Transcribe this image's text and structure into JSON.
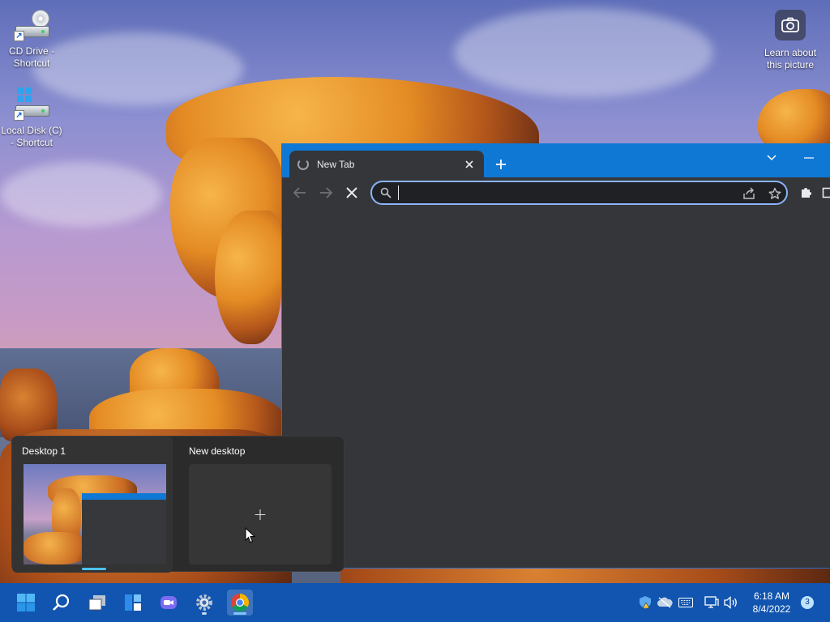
{
  "desktop": {
    "icons": [
      {
        "label": "CD Drive - Shortcut"
      },
      {
        "label": "Local Disk (C) - Shortcut"
      }
    ],
    "learn_picture": {
      "label": "Learn about this picture"
    }
  },
  "browser": {
    "tab": {
      "title": "New Tab",
      "loading": true
    },
    "omnibox": {
      "value": "",
      "placeholder": ""
    },
    "accent_color": "#0f78d4",
    "focus_color": "#8ab4f8"
  },
  "taskview": {
    "desktops": [
      {
        "label": "Desktop 1",
        "active": true
      }
    ],
    "new_desktop_label": "New desktop",
    "new_desktop_glyph": "+"
  },
  "taskbar": {
    "pinned": [
      "start-icon",
      "search-icon",
      "task-view-icon",
      "widgets-icon",
      "chat-icon",
      "settings-icon",
      "chrome-icon"
    ],
    "clock": {
      "time": "6:18 AM",
      "date": "8/4/2022"
    },
    "notification_count": "3",
    "color": "#1155b0"
  }
}
